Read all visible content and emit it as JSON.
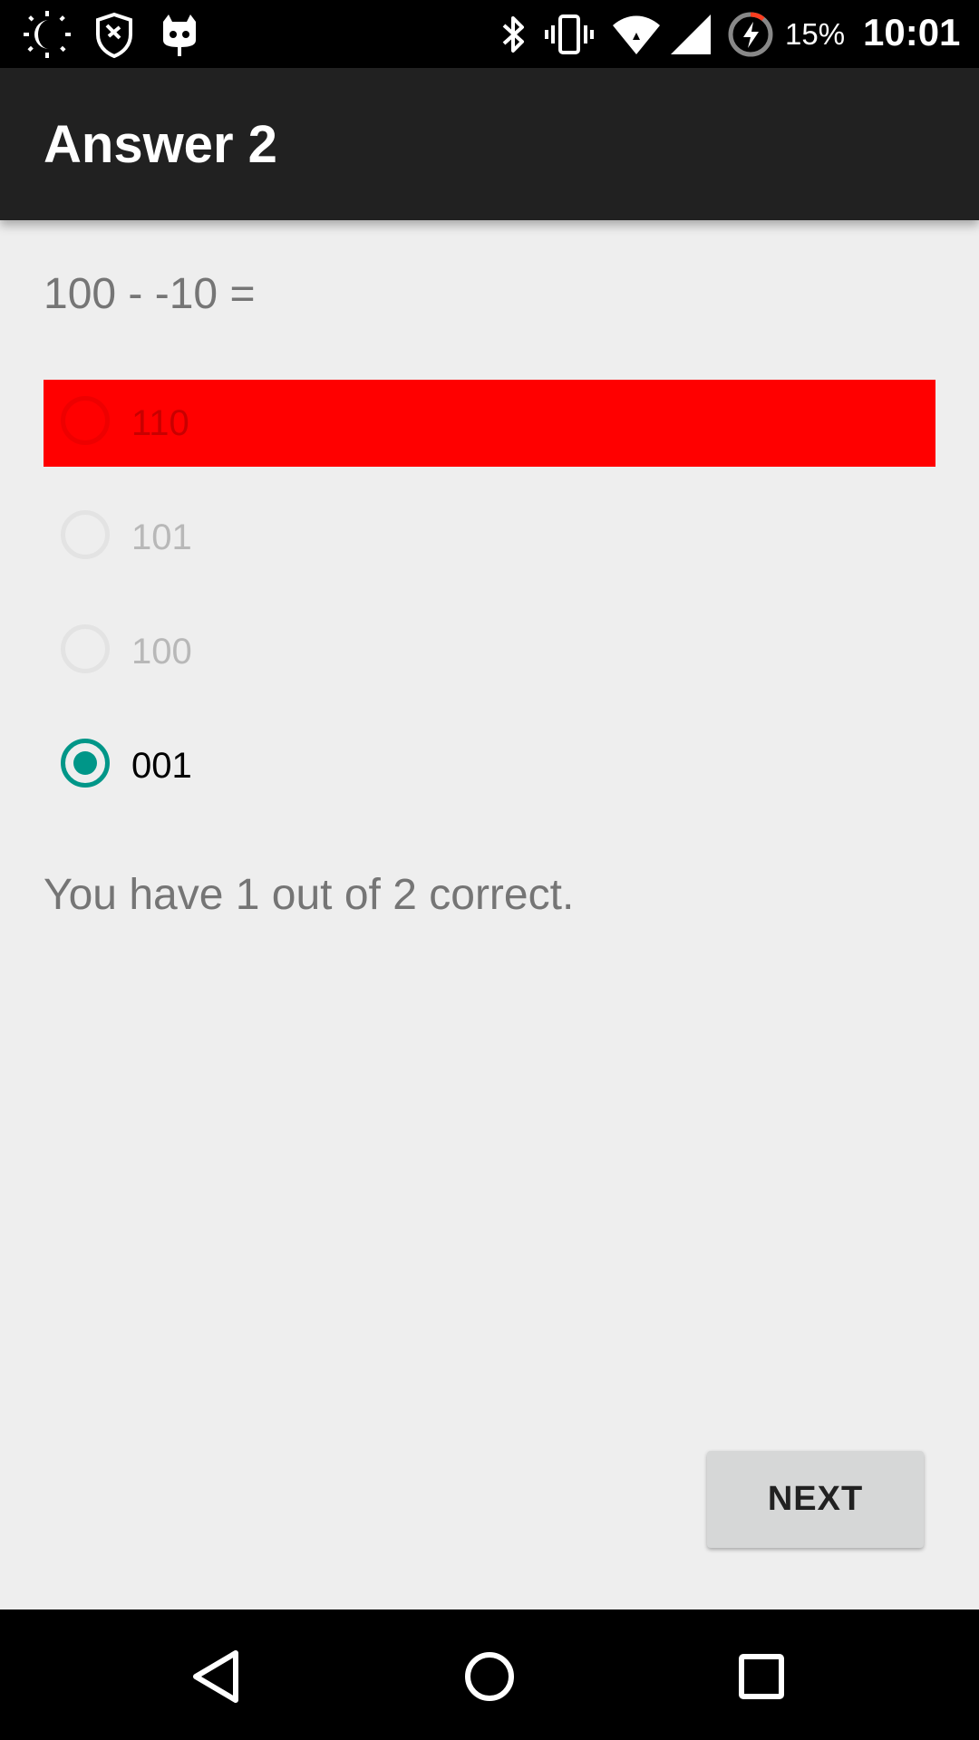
{
  "status_bar": {
    "icons": [
      "theme-toggle-icon",
      "privacy-guard-icon",
      "cyanogenmod-icon",
      "bluetooth-icon",
      "vibrate-icon",
      "wifi-icon",
      "cell-signal-icon",
      "battery-charging-icon"
    ],
    "battery_percent": "15%",
    "time": "10:01"
  },
  "app_bar": {
    "title": "Answer 2"
  },
  "question": {
    "text": "100 - -10 ="
  },
  "options": [
    {
      "label": "110",
      "state": "wrong"
    },
    {
      "label": "101",
      "state": "disabled"
    },
    {
      "label": "100",
      "state": "disabled"
    },
    {
      "label": "001",
      "state": "selected"
    }
  ],
  "score": {
    "text": "You have 1 out of 2 correct."
  },
  "next_button": {
    "label": "NEXT"
  },
  "nav_bar": {
    "buttons": [
      "back-icon",
      "home-icon",
      "recents-icon"
    ]
  },
  "colors": {
    "wrong": "#ff0000",
    "accent": "#009688",
    "app_bar": "#212121",
    "background": "#eeeeee"
  }
}
